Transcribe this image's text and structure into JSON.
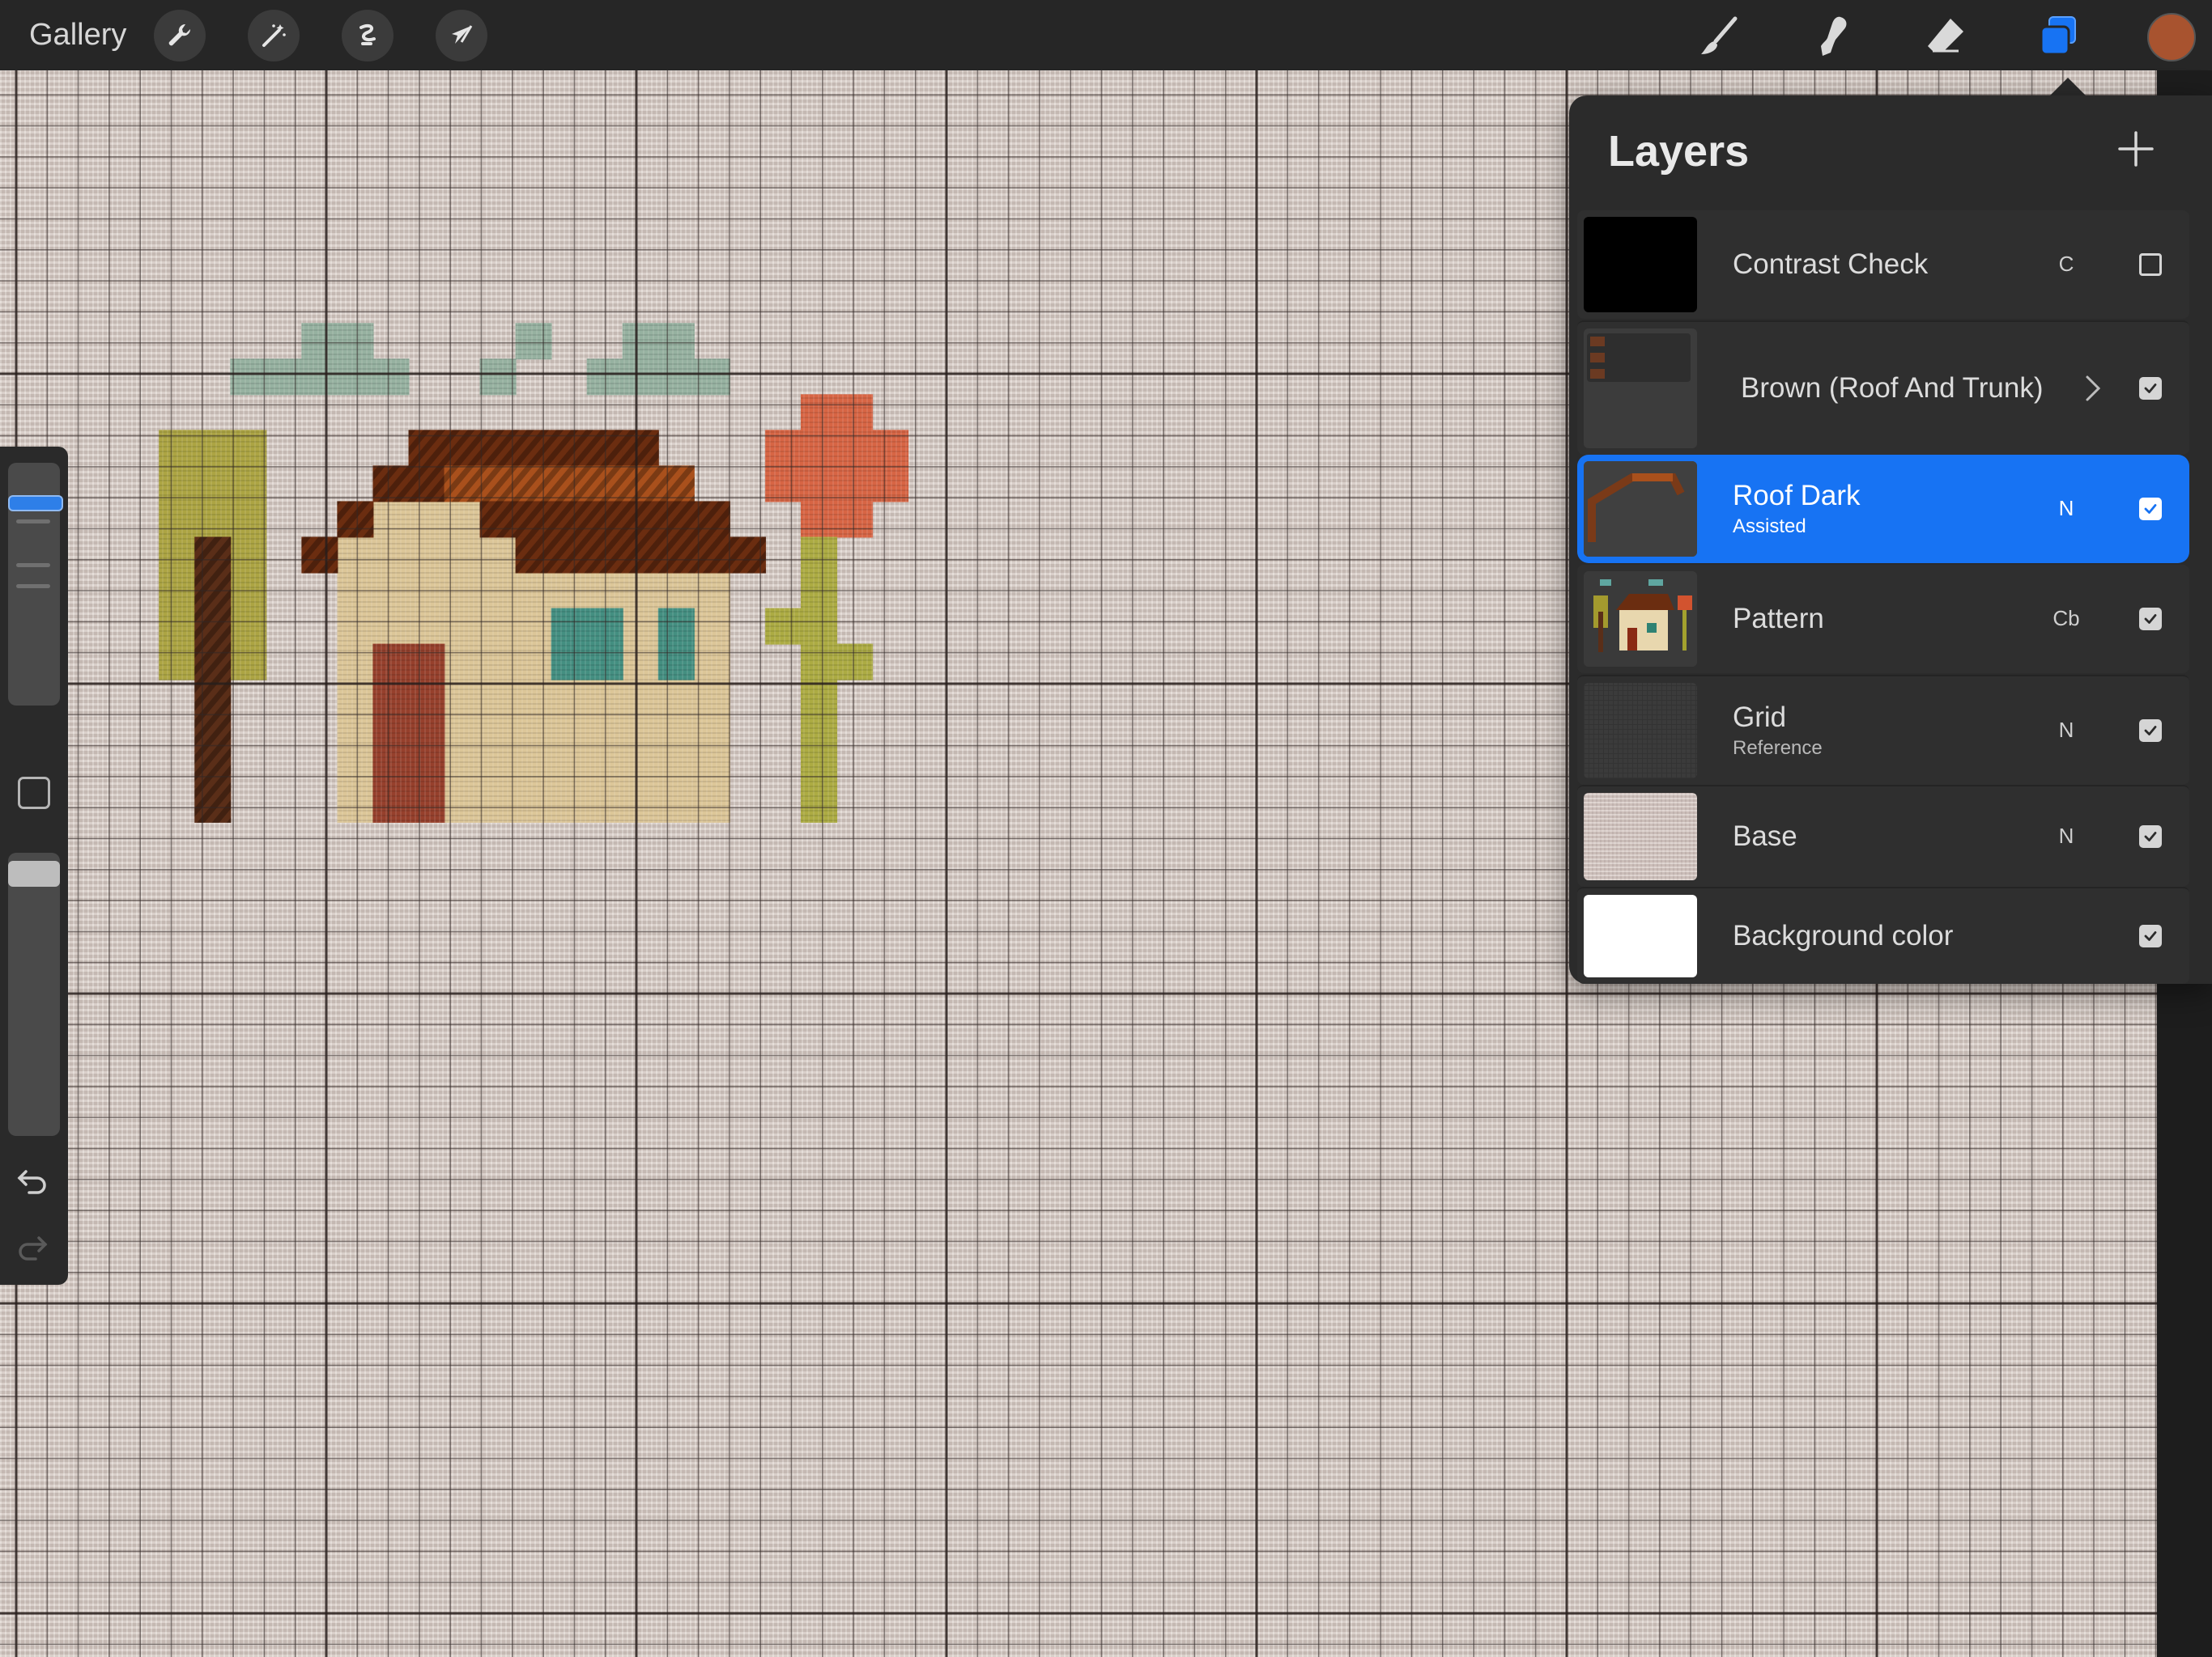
{
  "app": {
    "gallery_label": "Gallery"
  },
  "toolbar_left": [
    {
      "name": "wrench-icon"
    },
    {
      "name": "magic-wand-icon"
    },
    {
      "name": "selection-icon"
    },
    {
      "name": "transform-arrow-icon"
    }
  ],
  "toolbar_right": [
    {
      "name": "brush-icon"
    },
    {
      "name": "smudge-icon"
    },
    {
      "name": "eraser-icon"
    },
    {
      "name": "layers-icon"
    }
  ],
  "active_color": "#a8532f",
  "accent_color": "#1773f3",
  "layers_panel": {
    "title": "Layers",
    "add_icon": "plus-icon",
    "layers": [
      {
        "name": "Contrast Check",
        "sub": "",
        "blend": "C",
        "visible": false,
        "thumb": "black"
      },
      {
        "name": "Brown (Roof And Trunk)",
        "sub": "",
        "blend": "",
        "visible": true,
        "thumb": "group",
        "is_group": true
      },
      {
        "name": "Roof Dark",
        "sub": "Assisted",
        "blend": "N",
        "visible": true,
        "thumb": "roof",
        "active": true
      },
      {
        "name": "Pattern",
        "sub": "",
        "blend": "Cb",
        "visible": true,
        "thumb": "pattern"
      },
      {
        "name": "Grid",
        "sub": "Reference",
        "blend": "N",
        "visible": true,
        "thumb": "grid"
      },
      {
        "name": "Base",
        "sub": "",
        "blend": "N",
        "visible": true,
        "thumb": "base"
      },
      {
        "name": "Background color",
        "sub": "",
        "blend": "",
        "visible": true,
        "thumb": "white"
      }
    ]
  },
  "stitch_colors": {
    "sage": "#8aa895",
    "olive": "#a39a2e",
    "trunk": "#5a2e18",
    "roof_dark": "#6b2d10",
    "roof_orange": "#a9501c",
    "wall": "#d8bf8c",
    "door": "#8a2a14",
    "window": "#2f8273",
    "flower": "#d2532f",
    "stem": "#a3a12e"
  }
}
